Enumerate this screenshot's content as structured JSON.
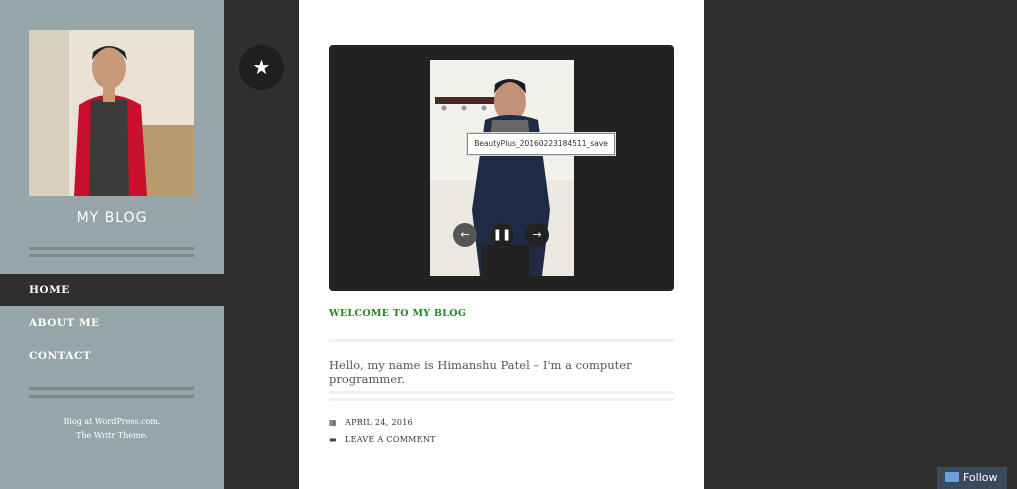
{
  "site": {
    "title": "MY BLOG"
  },
  "nav": {
    "items": [
      {
        "label": "HOME",
        "active": true
      },
      {
        "label": "ABOUT ME",
        "active": false
      },
      {
        "label": "CONTACT",
        "active": false
      }
    ]
  },
  "credits": {
    "line1": "Blog at WordPress.com.",
    "line2": "The Writr Theme."
  },
  "slideshow": {
    "caption": "BeautyPlus_20160223184511_save",
    "prev_icon": "arrow-left-icon",
    "pause_icon": "pause-icon",
    "next_icon": "arrow-right-icon"
  },
  "post": {
    "title": "WELCOME TO MY BLOG",
    "body": "Hello, my name is Himanshu Patel – I'm  a computer programmer.",
    "date": "APRIL 24, 2016",
    "comment_link": "LEAVE A COMMENT"
  },
  "follow": {
    "label": "Follow"
  },
  "colors": {
    "sidebar": "#96a5a7",
    "background": "#2f2f2f",
    "post_title": "#1e8a1e",
    "follow": "#3a4a5a"
  }
}
